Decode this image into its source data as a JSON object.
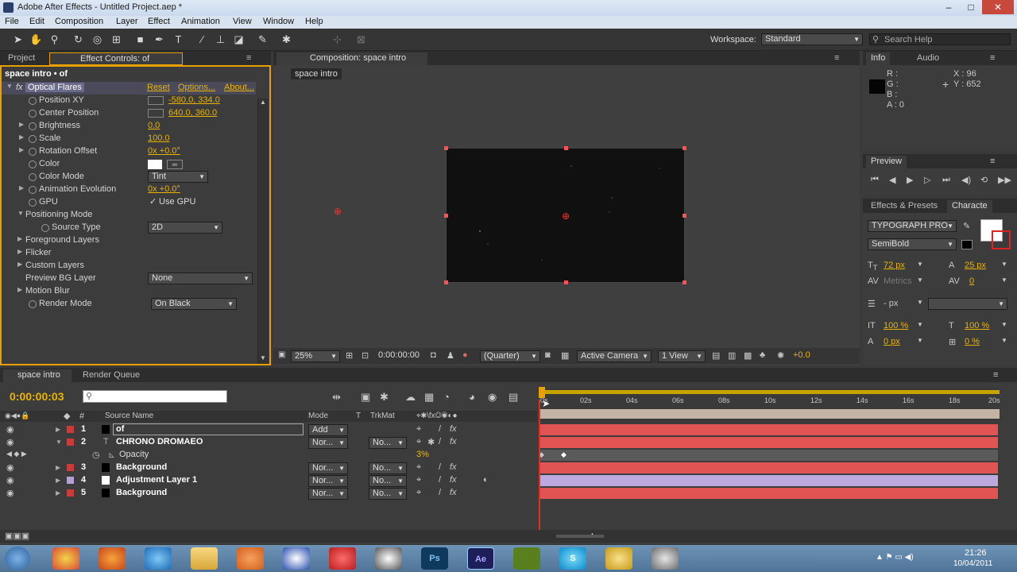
{
  "window": {
    "title": "Adobe After Effects - Untitled Project.aep *",
    "min": "–",
    "max": "□",
    "close": "✕"
  },
  "menu": [
    "File",
    "Edit",
    "Composition",
    "Layer",
    "Effect",
    "Animation",
    "View",
    "Window",
    "Help"
  ],
  "toolbar": {
    "workspace_label": "Workspace:",
    "workspace_value": "Standard",
    "search_placeholder": "Search Help"
  },
  "effect_panel": {
    "tab_project": "Project",
    "tab_effect": "Effect Controls: of",
    "layer_path": "space intro • of",
    "effect_name": "Optical Flares",
    "reset": "Reset",
    "options": "Options...",
    "about": "About...",
    "props": [
      {
        "label": "Position XY",
        "value": "-580.0, 334.0"
      },
      {
        "label": "Center Position",
        "value": "640.0, 360.0"
      },
      {
        "label": "Brightness",
        "value": "0.0"
      },
      {
        "label": "Scale",
        "value": "100.0"
      },
      {
        "label": "Rotation Offset",
        "value": "0x +0.0°"
      },
      {
        "label": "Color",
        "value": ""
      },
      {
        "label": "Color Mode",
        "value": "Tint"
      },
      {
        "label": "Animation Evolution",
        "value": "0x +0.0°"
      },
      {
        "label": "GPU",
        "value": "Use GPU"
      },
      {
        "label": "Positioning Mode",
        "value": ""
      },
      {
        "label": "Source Type",
        "value": "2D"
      },
      {
        "label": "Foreground Layers",
        "value": ""
      },
      {
        "label": "Flicker",
        "value": ""
      },
      {
        "label": "Custom Layers",
        "value": ""
      },
      {
        "label": "Preview BG Layer",
        "value": "None"
      },
      {
        "label": "Motion Blur",
        "value": ""
      },
      {
        "label": "Render Mode",
        "value": "On Black"
      }
    ]
  },
  "composition": {
    "tab": "Composition: space intro",
    "sub_tab": "space intro",
    "zoom": "25%",
    "time": "0:00:00:00",
    "resolution": "(Quarter)",
    "camera": "Active Camera",
    "views": "1 View",
    "exposure": "+0.0"
  },
  "info": {
    "tab_info": "Info",
    "tab_audio": "Audio",
    "r": "R :",
    "g": "G :",
    "b": "B :",
    "a": "A : 0",
    "x": "X : 96",
    "y": "Y : 652"
  },
  "preview": {
    "tab": "Preview"
  },
  "character": {
    "tab_effects": "Effects & Presets",
    "tab_char": "Characte",
    "font": "TYPOGRAPH PRO",
    "style": "SemiBold",
    "size": "72 px",
    "leading": "25 px",
    "kerning": "Metrics",
    "tracking": "0",
    "stroke": "- px",
    "vscale": "100 %",
    "hscale": "100 %",
    "baseline": "0 px",
    "tsume": "0 %"
  },
  "timeline": {
    "tab": "space intro",
    "tab_render": "Render Queue",
    "timecode": "0:00:00:03",
    "col_source": "Source Name",
    "col_mode": "Mode",
    "col_t": "T",
    "col_trkmat": "TrkMat",
    "ruler": [
      "0s",
      "02s",
      "04s",
      "06s",
      "08s",
      "10s",
      "12s",
      "14s",
      "16s",
      "18s",
      "20s"
    ],
    "layers": [
      {
        "num": "1",
        "name": "of",
        "mode": "Add",
        "trk": "",
        "color": "#c83c3c",
        "bar": "#e05454"
      },
      {
        "num": "2",
        "name": "CHRONO DROMAEO",
        "mode": "Nor...",
        "trk": "No...",
        "color": "#c83c3c",
        "bar": "#e05454"
      },
      {
        "num": "",
        "name": "Opacity",
        "mode": "",
        "trk": "",
        "value": "3%"
      },
      {
        "num": "3",
        "name": "Background",
        "mode": "Nor...",
        "trk": "No...",
        "color": "#c83c3c",
        "bar": "#e05454"
      },
      {
        "num": "4",
        "name": "Adjustment Layer 1",
        "mode": "Nor...",
        "trk": "No...",
        "color": "#b4a0d4",
        "bar": "#bca9dd"
      },
      {
        "num": "5",
        "name": "Background",
        "mode": "Nor...",
        "trk": "No...",
        "color": "#c83c3c",
        "bar": "#e05454"
      }
    ]
  },
  "taskbar": {
    "time": "21:26",
    "date": "10/04/2011"
  }
}
